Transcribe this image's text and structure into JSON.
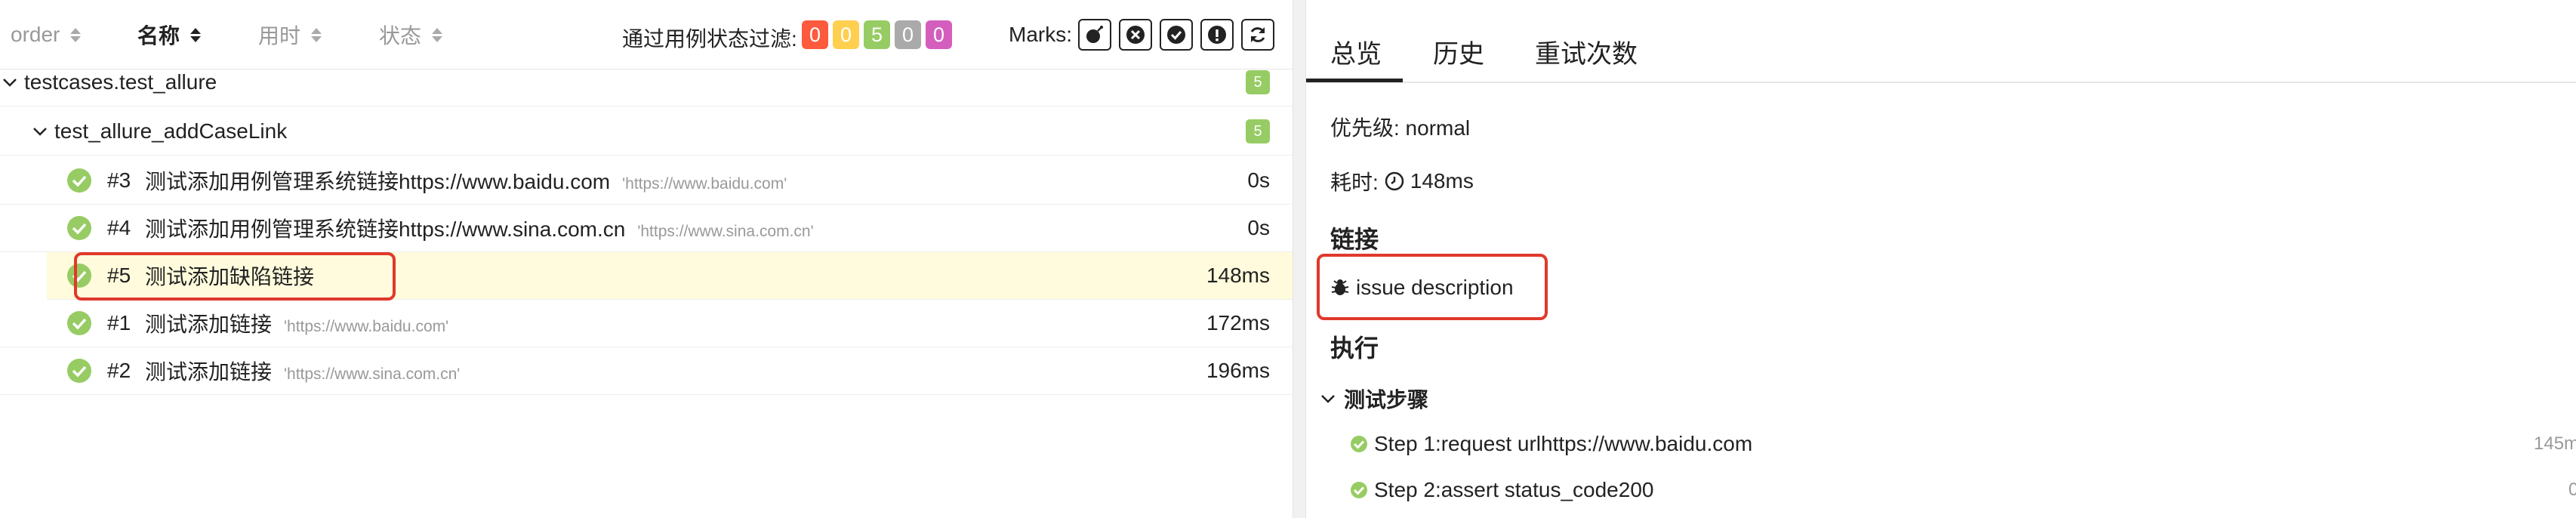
{
  "toolbar": {
    "sort_columns": [
      {
        "label": "order",
        "active": false
      },
      {
        "label": "名称",
        "active": true
      },
      {
        "label": "用时",
        "active": false
      },
      {
        "label": "状态",
        "active": false
      }
    ],
    "filter_label": "通过用例状态过滤:",
    "status_badges": [
      {
        "value": "0",
        "color": "#fd5a3e"
      },
      {
        "value": "0",
        "color": "#ffd050"
      },
      {
        "value": "5",
        "color": "#97cc64"
      },
      {
        "value": "0",
        "color": "#aaaaaa"
      },
      {
        "value": "0",
        "color": "#d35ebe"
      }
    ],
    "marks_label": "Marks:",
    "marks": [
      "bomb-icon",
      "x-circle-icon",
      "check-circle-icon",
      "exclamation-circle-icon",
      "refresh-icon"
    ]
  },
  "tree": {
    "suite": {
      "name": "testcases.test_allure",
      "count": "5"
    },
    "subsuite": {
      "name": "test_allure_addCaseLink",
      "count": "5"
    },
    "tests": [
      {
        "num": "#3",
        "name": "测试添加用例管理系统链接https://www.baidu.com",
        "param": "'https://www.baidu.com'",
        "duration": "0s"
      },
      {
        "num": "#4",
        "name": "测试添加用例管理系统链接https://www.sina.com.cn",
        "param": "'https://www.sina.com.cn'",
        "duration": "0s"
      },
      {
        "num": "#5",
        "name": "测试添加缺陷链接",
        "param": "",
        "duration": "148ms"
      },
      {
        "num": "#1",
        "name": "测试添加链接",
        "param": "'https://www.baidu.com'",
        "duration": "172ms"
      },
      {
        "num": "#2",
        "name": "测试添加链接",
        "param": "'https://www.sina.com.cn'",
        "duration": "196ms"
      }
    ]
  },
  "detail": {
    "tabs": [
      "总览",
      "历史",
      "重试次数"
    ],
    "severity": "优先级: normal",
    "duration_label": "耗时:",
    "duration_value": "148ms",
    "links_title": "链接",
    "link_text": "issue description",
    "execution_title": "执行",
    "steps_title": "测试步骤",
    "steps": [
      {
        "text": "Step 1:request urlhttps://www.baidu.com",
        "duration": "145m"
      },
      {
        "text": "Step 2:assert status_code200",
        "duration": "0"
      }
    ]
  },
  "colors": {
    "passed": "#97cc64",
    "highlight_border": "#e0392b",
    "selected_row": "#fffbdc"
  }
}
